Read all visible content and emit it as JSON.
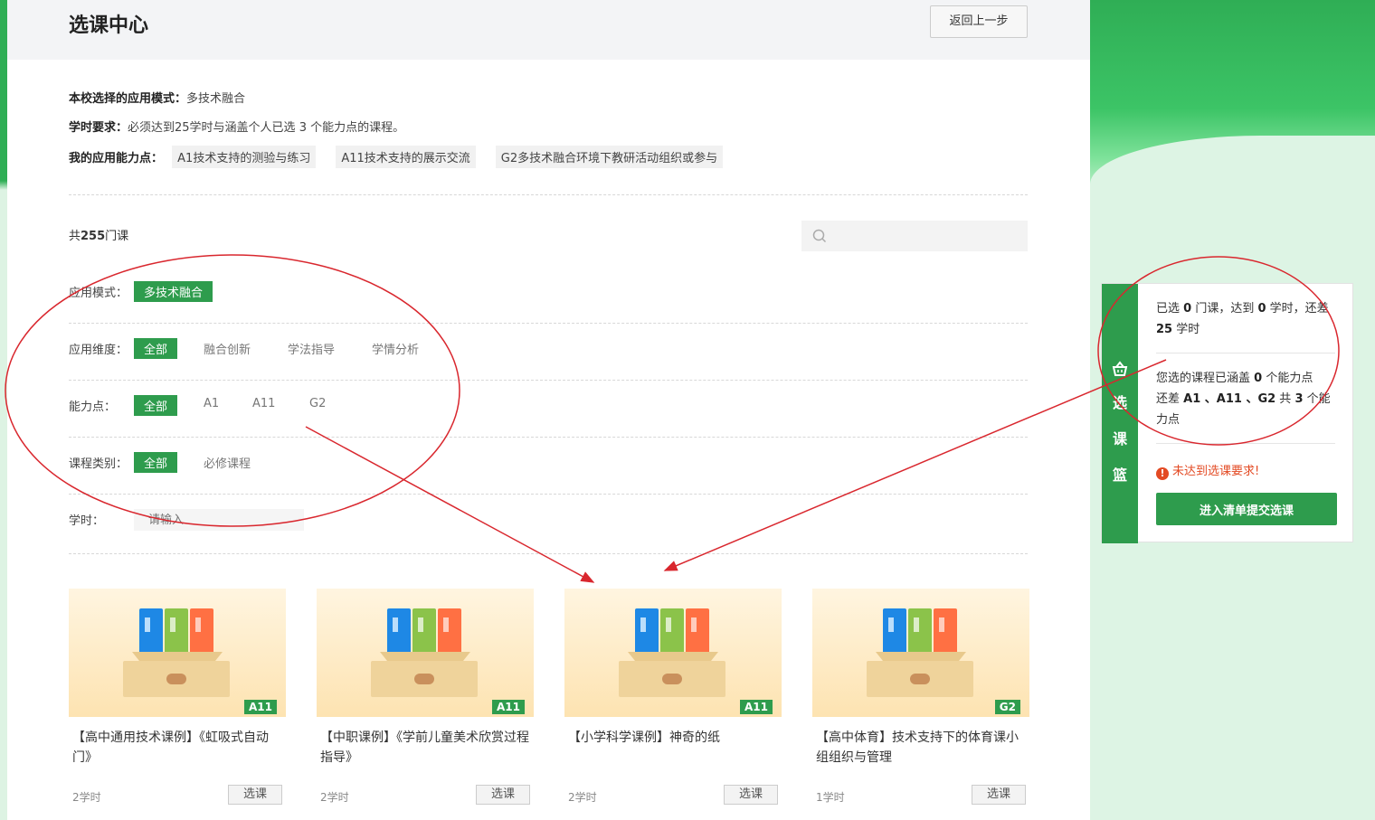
{
  "header": {
    "title": "选课中心",
    "back_label": "返回上一步"
  },
  "info": {
    "mode_label": "本校选择的应用模式：",
    "mode_value": "多技术融合",
    "hours_label": "学时要求：",
    "hours_value": "必须达到25学时与涵盖个人已选 3 个能力点的课程。",
    "abilities_label": "我的应用能力点：",
    "abilities": [
      "A1技术支持的测验与练习",
      "A11技术支持的展示交流",
      "G2多技术融合环境下教研活动组织或参与"
    ]
  },
  "total": {
    "prefix": "共",
    "count": "255",
    "suffix": "门课"
  },
  "search": {
    "placeholder": ""
  },
  "filters": {
    "mode": {
      "label": "应用模式：",
      "options": [
        "多技术融合"
      ]
    },
    "dimension": {
      "label": "应用维度：",
      "options": [
        "全部",
        "融合创新",
        "学法指导",
        "学情分析"
      ]
    },
    "ability": {
      "label": "能力点：",
      "options": [
        "全部",
        "A1",
        "A11",
        "G2"
      ]
    },
    "category": {
      "label": "课程类别：",
      "options": [
        "全部",
        "必修课程"
      ]
    },
    "hours": {
      "label": "学时：",
      "placeholder": "请输入"
    }
  },
  "courses": [
    {
      "badge": "A11",
      "title": "【高中通用技术课例】《虹吸式自动门》",
      "hours": "2学时",
      "select_label": "选课"
    },
    {
      "badge": "A11",
      "title": "【中职课例】《学前儿童美术欣赏过程指导》",
      "hours": "2学时",
      "select_label": "选课"
    },
    {
      "badge": "A11",
      "title": "【小学科学课例】神奇的纸",
      "hours": "2学时",
      "select_label": "选课"
    },
    {
      "badge": "G2",
      "title": "【高中体育】技术支持下的体育课小组组织与管理",
      "hours": "1学时",
      "select_label": "选课"
    }
  ],
  "basket": {
    "tab_chars": [
      "选",
      "课",
      "篮"
    ],
    "line1": {
      "a": "已选 ",
      "courses": "0",
      "b": " 门课，达到 ",
      "hours": "0",
      "c": " 学时，还差 ",
      "remain": "25",
      "d": " 学时"
    },
    "line2": {
      "a": "您选的课程已涵盖 ",
      "covered": "0",
      "b": " 个能力点",
      "c": "还差 ",
      "missing": "A1 、A11 、G2",
      "d": " 共 ",
      "count": "3",
      "e": " 个能力点"
    },
    "warning": "未达到选课要求!",
    "submit_label": "进入清单提交选课"
  },
  "colors": {
    "accent": "#2e9c4d",
    "warning": "#e34a23",
    "annotation": "#d9272e"
  },
  "icons": {
    "search": "search-icon",
    "basket": "basket-icon",
    "warning": "warning-icon",
    "binder": "folder-box-icon"
  }
}
